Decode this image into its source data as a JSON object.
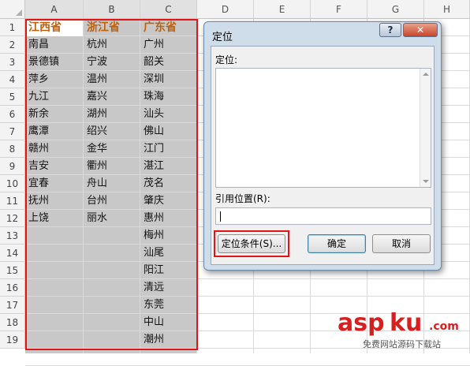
{
  "columns": [
    "A",
    "B",
    "C",
    "D",
    "E",
    "F",
    "G",
    "H"
  ],
  "rows": [
    "1",
    "2",
    "3",
    "4",
    "5",
    "6",
    "7",
    "8",
    "9",
    "10",
    "11",
    "12",
    "13",
    "14",
    "15",
    "16",
    "17",
    "18",
    "19"
  ],
  "headers": [
    "江西省",
    "浙江省",
    "广东省"
  ],
  "col_a": [
    "南昌",
    "景德镇",
    "萍乡",
    "九江",
    "新余",
    "鹰潭",
    "赣州",
    "吉安",
    "宜春",
    "抚州",
    "上饶"
  ],
  "col_b": [
    "杭州",
    "宁波",
    "温州",
    "嘉兴",
    "湖州",
    "绍兴",
    "金华",
    "衢州",
    "舟山",
    "台州",
    "丽水"
  ],
  "col_c": [
    "广州",
    "韶关",
    "深圳",
    "珠海",
    "汕头",
    "佛山",
    "江门",
    "湛江",
    "茂名",
    "肇庆",
    "惠州",
    "梅州",
    "汕尾",
    "阳江",
    "清远",
    "东莞",
    "中山",
    "潮州"
  ],
  "dialog": {
    "title": "定位",
    "help": "?",
    "close": "✕",
    "goto_label": "定位:",
    "reference_label": "引用位置(R):",
    "reference_value": "",
    "special_button": "定位条件(S)...",
    "ok_button": "确定",
    "cancel_button": "取消"
  },
  "watermark": {
    "asp": "asp",
    "ku": "ku",
    "suffix": ".com",
    "sub": "免费网站源码下载站"
  },
  "colors": {
    "highlight": "#e31414",
    "header_text": "#c0600a",
    "selection": "#c8c8c8"
  }
}
